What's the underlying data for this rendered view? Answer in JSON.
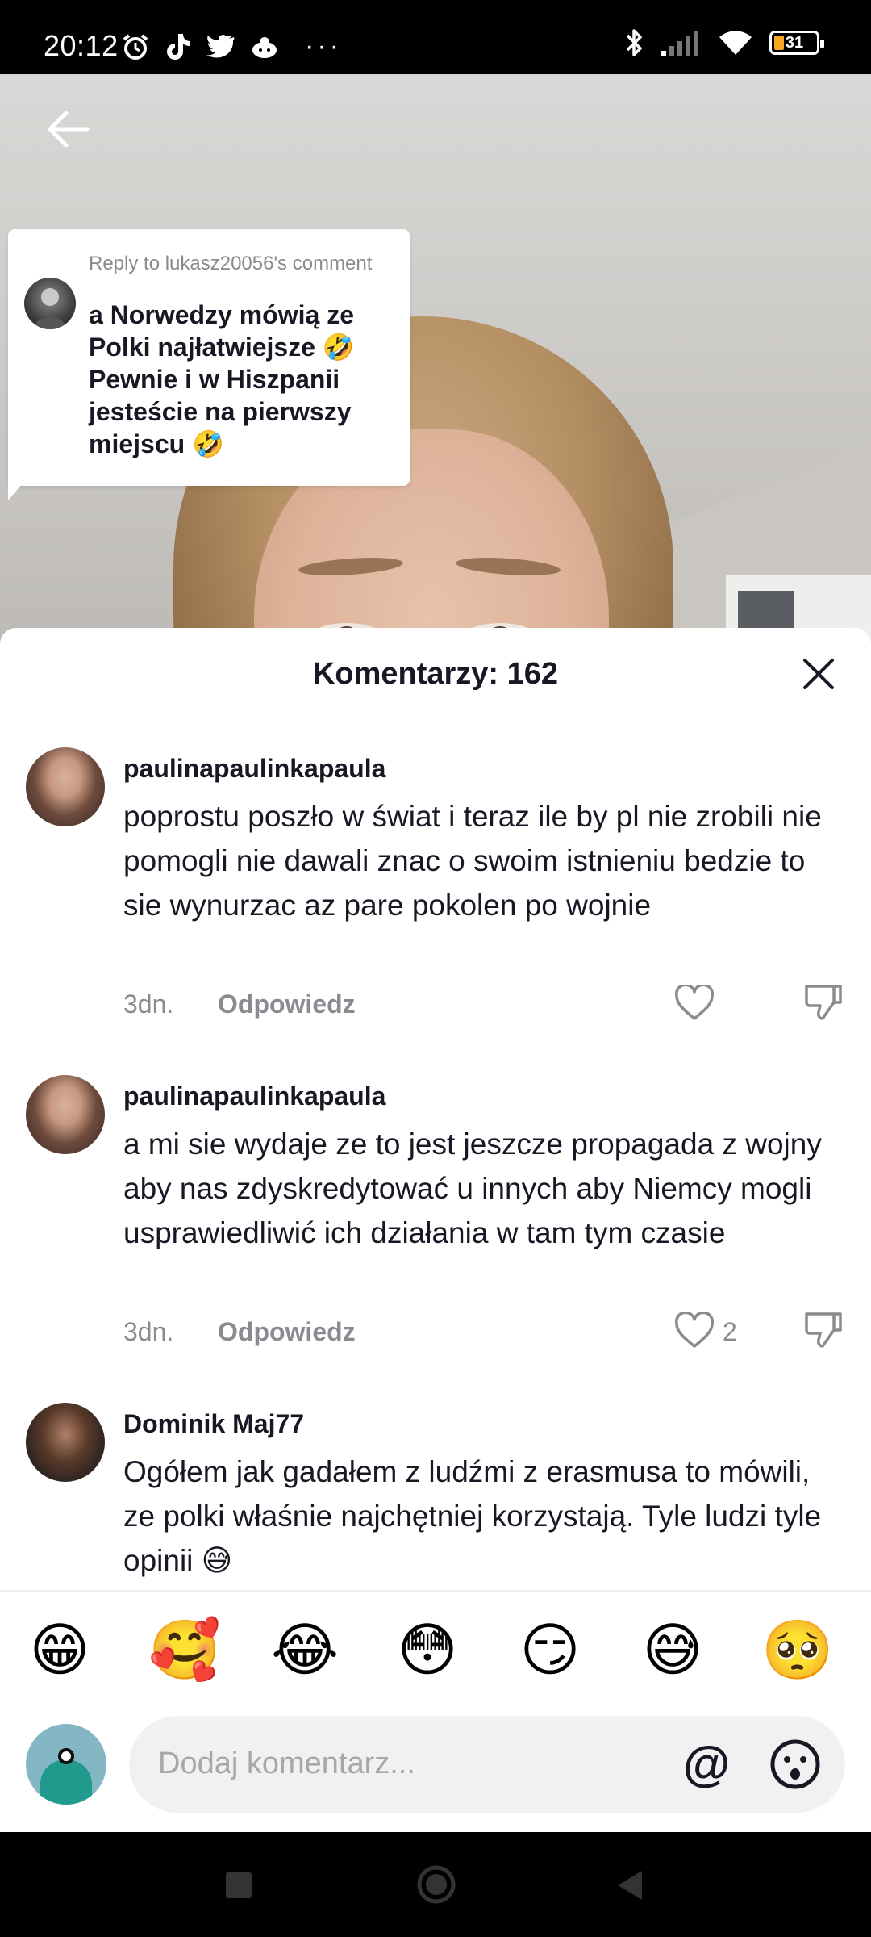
{
  "status_bar": {
    "time": "20:12",
    "battery": "31",
    "icons_left": [
      "alarm-icon",
      "tiktok-icon",
      "twitter-icon",
      "cloud-icon",
      "more-icon"
    ],
    "icons_right": [
      "bluetooth-icon",
      "signal-icon",
      "wifi-icon",
      "battery-icon"
    ],
    "more_label": "···"
  },
  "video": {
    "reply_bubble": {
      "heading": "Reply to lukasz20056's comment",
      "text": "a Norwedzy mówią ze Polki najłatwiejsze 🤣 Pewnie i w Hiszpanii jesteście na pierwszy miejscu 🤣"
    }
  },
  "comments_sheet": {
    "title": "Komentarzy: 162",
    "reply_label": "Odpowiedz",
    "comments": [
      {
        "user": "paulinapaulinkapaula",
        "text": "poprostu poszło w świat i teraz ile by pl nie zrobili nie pomogli nie dawali znac o swoim istnieniu bedzie to sie wynurzac az pare pokolen po wojnie",
        "date": "3dn.",
        "likes": ""
      },
      {
        "user": "paulinapaulinkapaula",
        "text": "a mi sie wydaje ze to jest jeszcze propagada z wojny aby nas zdyskredytować u innych aby Niemcy mogli usprawiedliwić ich działania w tam tym czasie",
        "date": "3dn.",
        "likes": "2"
      },
      {
        "user": "Dominik Maj77",
        "text": "Ogółem jak gadałem z ludźmi z erasmusa to mówili, ze polki właśnie najchętniej korzystają. Tyle ludzi tyle opinii 😅",
        "date": "",
        "likes": ""
      }
    ]
  },
  "emoji_bar": [
    "😁",
    "🥰",
    "😂",
    "😳",
    "😏",
    "😅",
    "🥺"
  ],
  "comment_input": {
    "placeholder": "Dodaj komentarz...",
    "at_label": "@"
  },
  "colors": {
    "text_primary": "#161823",
    "text_secondary": "#8a8b91",
    "input_bg": "#f1f1f2"
  }
}
